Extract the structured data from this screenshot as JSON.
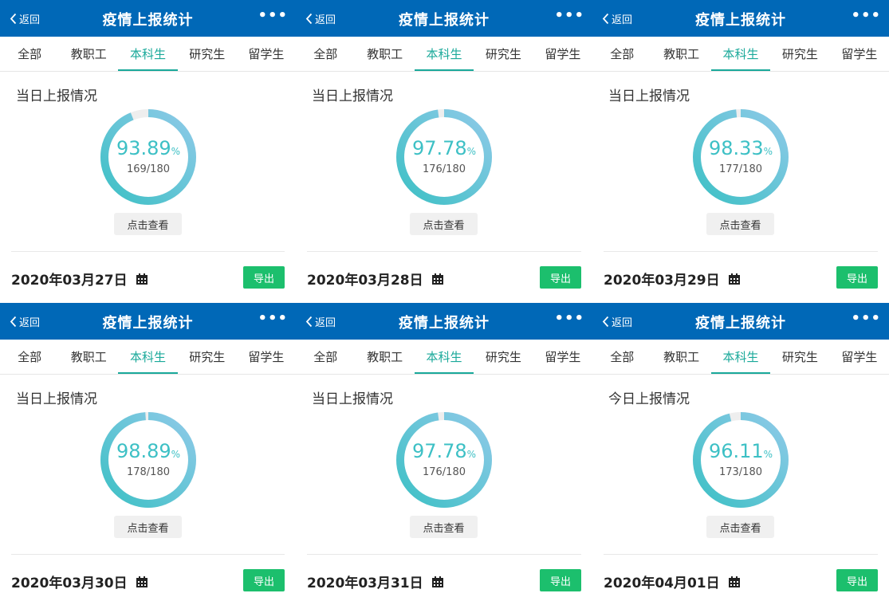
{
  "header": {
    "back_label": "返回",
    "title": "疫情上报统计",
    "more_label": "•••"
  },
  "tabs": [
    "全部",
    "教职工",
    "本科生",
    "研究生",
    "留学生"
  ],
  "active_tab": 2,
  "view_button_label": "点击查看",
  "export_button_label": "导出",
  "colors": {
    "header_bg": "#0068b7",
    "accent": "#1aa99a",
    "export_bg": "#1cbf6d",
    "ring_start": "#3dc0c5",
    "ring_end": "#8ecae8",
    "ring_track": "#eeeeee"
  },
  "panels": [
    {
      "section_title": "当日上报情况",
      "percent": "93.89",
      "percent_symbol": "%",
      "fraction": "169/180",
      "reported": 169,
      "total": 180,
      "date": "2020年03月27日"
    },
    {
      "section_title": "当日上报情况",
      "percent": "97.78",
      "percent_symbol": "%",
      "fraction": "176/180",
      "reported": 176,
      "total": 180,
      "date": "2020年03月28日"
    },
    {
      "section_title": "当日上报情况",
      "percent": "98.33",
      "percent_symbol": "%",
      "fraction": "177/180",
      "reported": 177,
      "total": 180,
      "date": "2020年03月29日"
    },
    {
      "section_title": "当日上报情况",
      "percent": "98.89",
      "percent_symbol": "%",
      "fraction": "178/180",
      "reported": 178,
      "total": 180,
      "date": "2020年03月30日"
    },
    {
      "section_title": "当日上报情况",
      "percent": "97.78",
      "percent_symbol": "%",
      "fraction": "176/180",
      "reported": 176,
      "total": 180,
      "date": "2020年03月31日"
    },
    {
      "section_title": "今日上报情况",
      "percent": "96.11",
      "percent_symbol": "%",
      "fraction": "173/180",
      "reported": 173,
      "total": 180,
      "date": "2020年04月01日"
    }
  ]
}
